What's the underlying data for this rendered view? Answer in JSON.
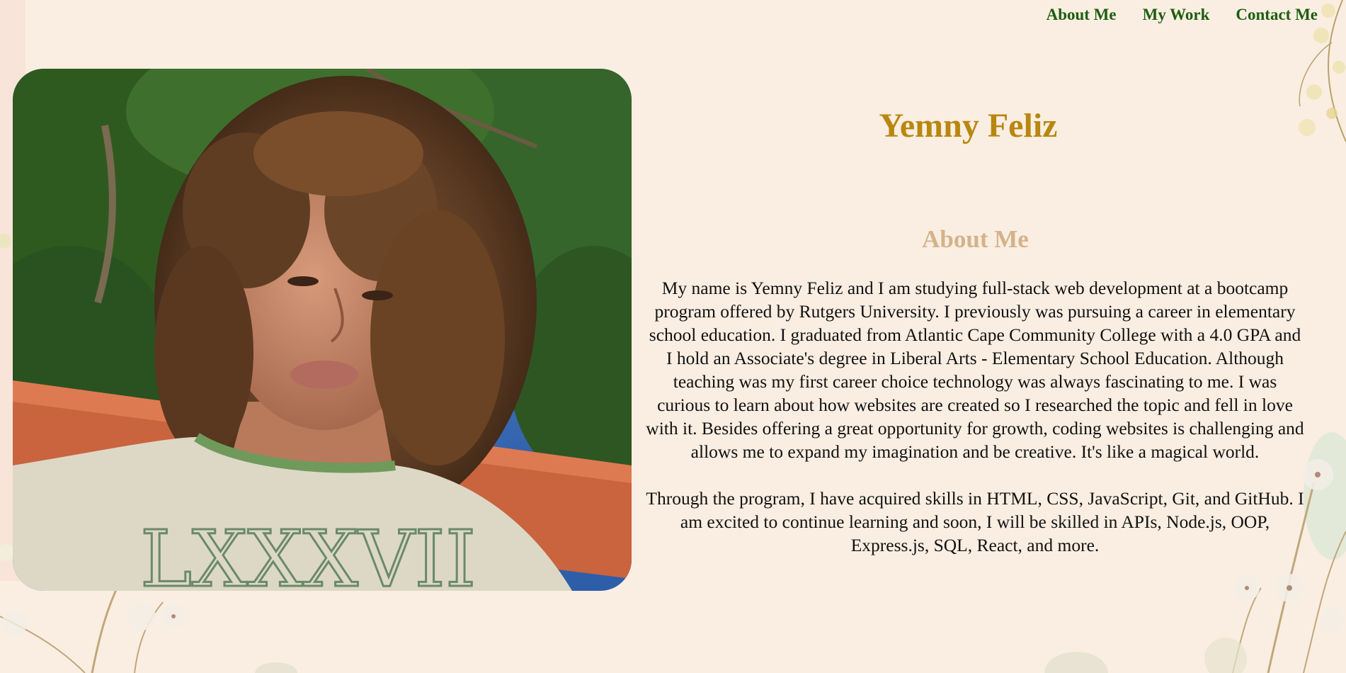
{
  "nav": {
    "items": [
      {
        "label": "About Me"
      },
      {
        "label": "My Work"
      },
      {
        "label": "Contact Me"
      }
    ]
  },
  "hero": {
    "name": "Yemny Feliz",
    "photo_alt": "Portrait photo"
  },
  "about": {
    "heading": "About Me",
    "paragraph_1": "My name is Yemny Feliz and I am studying full-stack web development at a bootcamp program offered by Rutgers University. I previously was pursuing a career in elementary school education. I graduated from Atlantic Cape Community College with a 4.0 GPA and I hold an Associate's degree in Liberal Arts - Elementary School Education. Although teaching was my first career choice technology was always fascinating to me. I was curious to learn about how websites are created so I researched the topic and fell in love with it. Besides offering a great opportunity for growth, coding websites is challenging and allows me to expand my imagination and be creative. It's like a magical world.",
    "paragraph_2": "Through the program, I have acquired skills in HTML, CSS, JavaScript, Git, and GitHub. I am excited to continue learning and soon, I will be skilled in APIs, Node.js, OOP, Express.js, SQL, React, and more."
  },
  "colors": {
    "background": "#faeee2",
    "nav_link": "#1d5e0f",
    "title": "#b8870f",
    "section_heading": "#d4b38a"
  }
}
